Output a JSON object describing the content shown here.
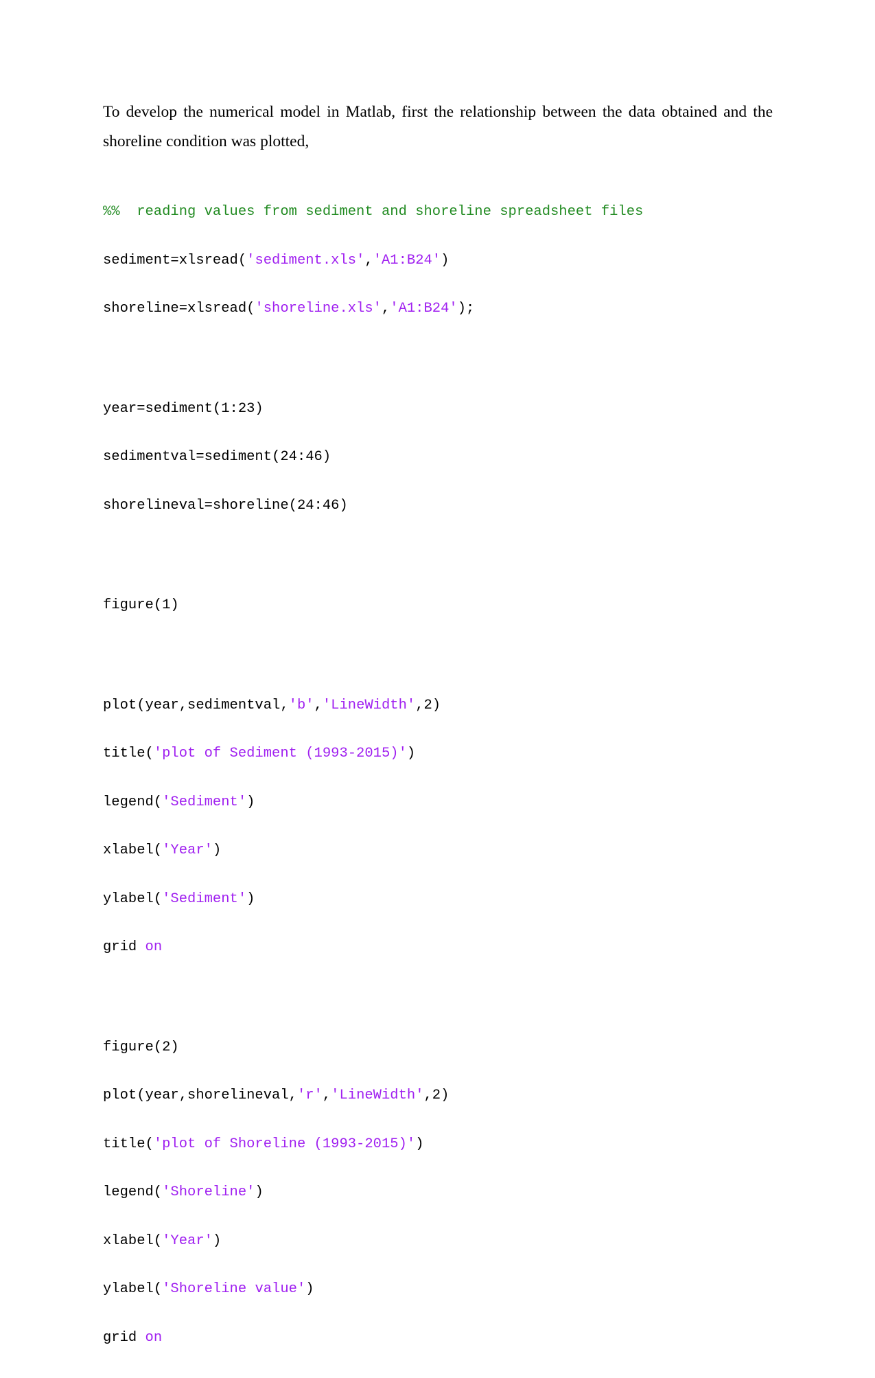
{
  "paragraph": "To develop the numerical model in Matlab, first the relationship between the data obtained and the shoreline condition was plotted,",
  "colors": {
    "text": "#000000",
    "comment": "#228b22",
    "string": "#a020f0"
  },
  "code": {
    "block1": {
      "comment": "%%  reading values from sediment and shoreline spreadsheet files",
      "l2": {
        "a": "sediment=xlsread(",
        "s1": "'sediment.xls'",
        "b": ",",
        "s2": "'A1:B24'",
        "c": ")"
      },
      "l3": {
        "a": "shoreline=xlsread(",
        "s1": "'shoreline.xls'",
        "b": ",",
        "s2": "'A1:B24'",
        "c": ");"
      }
    },
    "block2": [
      "year=sediment(1:23)",
      "sedimentval=sediment(24:46)",
      "shorelineval=shoreline(24:46)"
    ],
    "block3": "figure(1)",
    "block4": {
      "plot": {
        "a": "plot(year,sedimentval,",
        "s1": "'b'",
        "b": ",",
        "s2": "'LineWidth'",
        "c": ",2)"
      },
      "title": {
        "a": "title(",
        "s": "'plot of Sediment (1993-2015)'",
        "c": ")"
      },
      "legend": {
        "a": "legend(",
        "s": "'Sediment'",
        "c": ")"
      },
      "xlabel": {
        "a": "xlabel(",
        "s": "'Year'",
        "c": ")"
      },
      "ylabel": {
        "a": "ylabel(",
        "s": "'Sediment'",
        "c": ")"
      },
      "grid": {
        "a": "grid ",
        "k": "on"
      }
    },
    "block5": {
      "figure": "figure(2)",
      "plot": {
        "a": "plot(year,shorelineval,",
        "s1": "'r'",
        "b": ",",
        "s2": "'LineWidth'",
        "c": ",2)"
      },
      "title": {
        "a": "title(",
        "s": "'plot of Shoreline (1993-2015)'",
        "c": ")"
      },
      "legend": {
        "a": "legend(",
        "s": "'Shoreline'",
        "c": ")"
      },
      "xlabel": {
        "a": "xlabel(",
        "s": "'Year'",
        "c": ")"
      },
      "ylabel": {
        "a": "ylabel(",
        "s": "'Shoreline value'",
        "c": ")"
      },
      "grid": {
        "a": "grid ",
        "k": "on"
      }
    }
  }
}
